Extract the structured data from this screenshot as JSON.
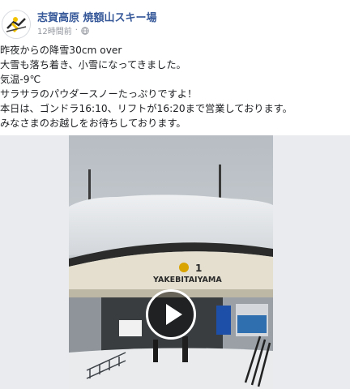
{
  "post": {
    "page_name": "志賀高原 焼額山スキー場",
    "timestamp": "12時間前",
    "separator": "·",
    "privacy_icon": "globe-icon",
    "lines": [
      "昨夜からの降雪30cm over",
      "大雪も落ち着き、小雪になってきました。",
      "気温-9℃",
      "サラサラのパウダースノーたっぷりですよ！",
      "本日は、ゴンドラ16:10、リフトが16:20まで営業しております。",
      "みなさまのお越しをお待ちしております。"
    ]
  },
  "video": {
    "building_sign": "YAKEBITAIYAMA",
    "building_number": "1",
    "play_icon": "play-icon"
  },
  "colors": {
    "link": "#365899",
    "meta": "#90949c",
    "logo_yellow": "#f2c200"
  }
}
